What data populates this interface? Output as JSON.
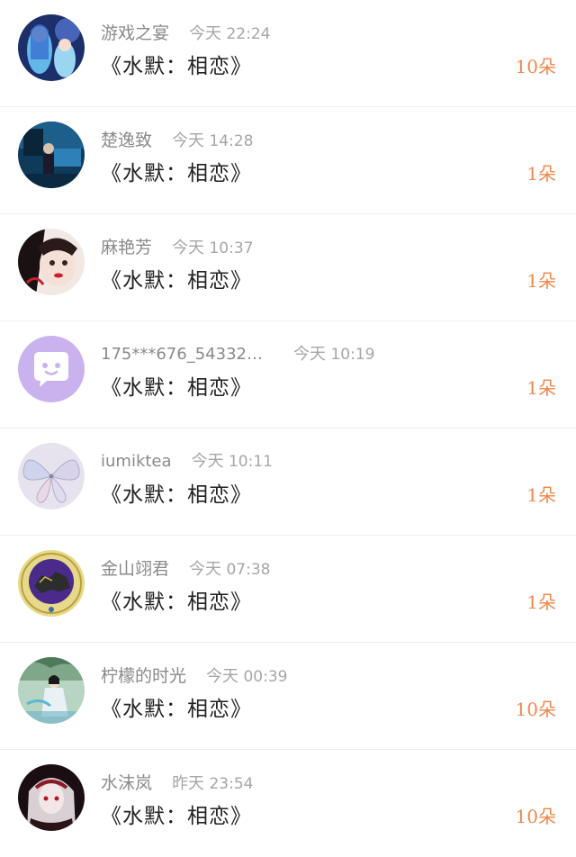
{
  "items": [
    {
      "name": "游戏之宴",
      "day": "今天",
      "time": "22:24",
      "title": "《水默：相恋》",
      "count": "10朵",
      "avatar": "avatar-anime-blue"
    },
    {
      "name": "楚逸致",
      "day": "今天",
      "time": "14:28",
      "title": "《水默：相恋》",
      "count": "1朵",
      "avatar": "avatar-photo-blue"
    },
    {
      "name": "麻艳芳",
      "day": "今天",
      "time": "10:37",
      "title": "《水默：相恋》",
      "count": "1朵",
      "avatar": "avatar-photo-face"
    },
    {
      "name": "175***676_54332…",
      "day": "今天",
      "time": "10:19",
      "title": "《水默：相恋》",
      "count": "1朵",
      "avatar": "chat-bubble-icon"
    },
    {
      "name": "iumiktea",
      "day": "今天",
      "time": "10:11",
      "title": "《水默：相恋》",
      "count": "1朵",
      "avatar": "avatar-butterfly"
    },
    {
      "name": "金山翊君",
      "day": "今天",
      "time": "07:38",
      "title": "《水默：相恋》",
      "count": "1朵",
      "avatar": "avatar-emblem"
    },
    {
      "name": "柠檬的时光",
      "day": "今天",
      "time": "00:39",
      "title": "《水默：相恋》",
      "count": "10朵",
      "avatar": "avatar-photo-green"
    },
    {
      "name": "水沫岚",
      "day": "昨天",
      "time": "23:54",
      "title": "《水默：相恋》",
      "count": "10朵",
      "avatar": "avatar-anime-dark"
    }
  ],
  "colors": {
    "accent": "#f0874a",
    "name_text": "#8a8a8a",
    "title_text": "#222222",
    "divider": "#eeeeee",
    "chat_avatar_bg": "#c9b2ee"
  }
}
